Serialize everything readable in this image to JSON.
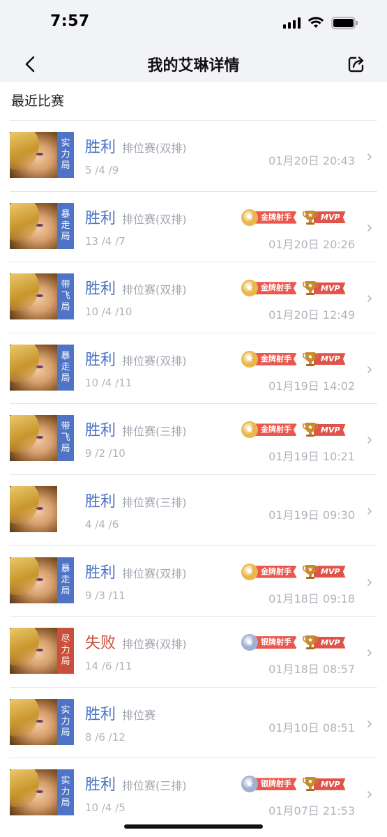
{
  "status_bar": {
    "time": "7:57"
  },
  "nav": {
    "title": "我的艾琳详情",
    "back_icon": "chevron-left-icon",
    "share_icon": "share-icon"
  },
  "section": {
    "title": "最近比赛"
  },
  "colors": {
    "win": "#4a72c4",
    "lose": "#c9503d",
    "tag_blue": "#5074c5",
    "tag_red": "#c9503d",
    "gold": "#e9b84a",
    "silver": "#9fb1d3"
  },
  "matches": [
    {
      "result": "胜利",
      "mode": "排位赛(双排)",
      "kda": "5 /4 /9",
      "datetime": "01月20日 20:43",
      "tag": [
        "实",
        "力",
        "局"
      ],
      "tag_color": "blue",
      "medal": null,
      "mvp": false
    },
    {
      "result": "胜利",
      "mode": "排位赛(双排)",
      "kda": "13 /4 /7",
      "datetime": "01月20日 20:26",
      "tag": [
        "暴",
        "走",
        "局"
      ],
      "tag_color": "blue",
      "medal": {
        "type": "gold",
        "label": "金牌射手"
      },
      "mvp": true
    },
    {
      "result": "胜利",
      "mode": "排位赛(双排)",
      "kda": "10 /4 /10",
      "datetime": "01月20日 12:49",
      "tag": [
        "带",
        "飞",
        "局"
      ],
      "tag_color": "blue",
      "medal": {
        "type": "gold",
        "label": "金牌射手"
      },
      "mvp": true
    },
    {
      "result": "胜利",
      "mode": "排位赛(双排)",
      "kda": "10 /4 /11",
      "datetime": "01月19日 14:02",
      "tag": [
        "暴",
        "走",
        "局"
      ],
      "tag_color": "blue",
      "medal": {
        "type": "gold",
        "label": "金牌射手"
      },
      "mvp": true
    },
    {
      "result": "胜利",
      "mode": "排位赛(三排)",
      "kda": "9 /2 /10",
      "datetime": "01月19日 10:21",
      "tag": [
        "带",
        "飞",
        "局"
      ],
      "tag_color": "blue",
      "medal": {
        "type": "gold",
        "label": "金牌射手"
      },
      "mvp": true
    },
    {
      "result": "胜利",
      "mode": "排位赛(三排)",
      "kda": "4 /4 /6",
      "datetime": "01月19日 09:30",
      "tag": null,
      "tag_color": null,
      "medal": null,
      "mvp": false
    },
    {
      "result": "胜利",
      "mode": "排位赛(双排)",
      "kda": "9 /3 /11",
      "datetime": "01月18日 09:18",
      "tag": [
        "暴",
        "走",
        "局"
      ],
      "tag_color": "blue",
      "medal": {
        "type": "gold",
        "label": "金牌射手"
      },
      "mvp": true
    },
    {
      "result": "失败",
      "mode": "排位赛(双排)",
      "kda": "14 /6 /11",
      "datetime": "01月18日 08:57",
      "tag": [
        "尽",
        "力",
        "局"
      ],
      "tag_color": "red",
      "medal": {
        "type": "silver",
        "label": "银牌射手"
      },
      "mvp": true
    },
    {
      "result": "胜利",
      "mode": "排位赛",
      "kda": "8 /6 /12",
      "datetime": "01月10日 08:51",
      "tag": [
        "实",
        "力",
        "局"
      ],
      "tag_color": "blue",
      "medal": null,
      "mvp": false
    },
    {
      "result": "胜利",
      "mode": "排位赛(三排)",
      "kda": "10 /4 /5",
      "datetime": "01月07日 21:53",
      "tag": [
        "实",
        "力",
        "局"
      ],
      "tag_color": "blue",
      "medal": {
        "type": "silver",
        "label": "银牌射手"
      },
      "mvp": true
    }
  ],
  "mvp_label": "MVP"
}
